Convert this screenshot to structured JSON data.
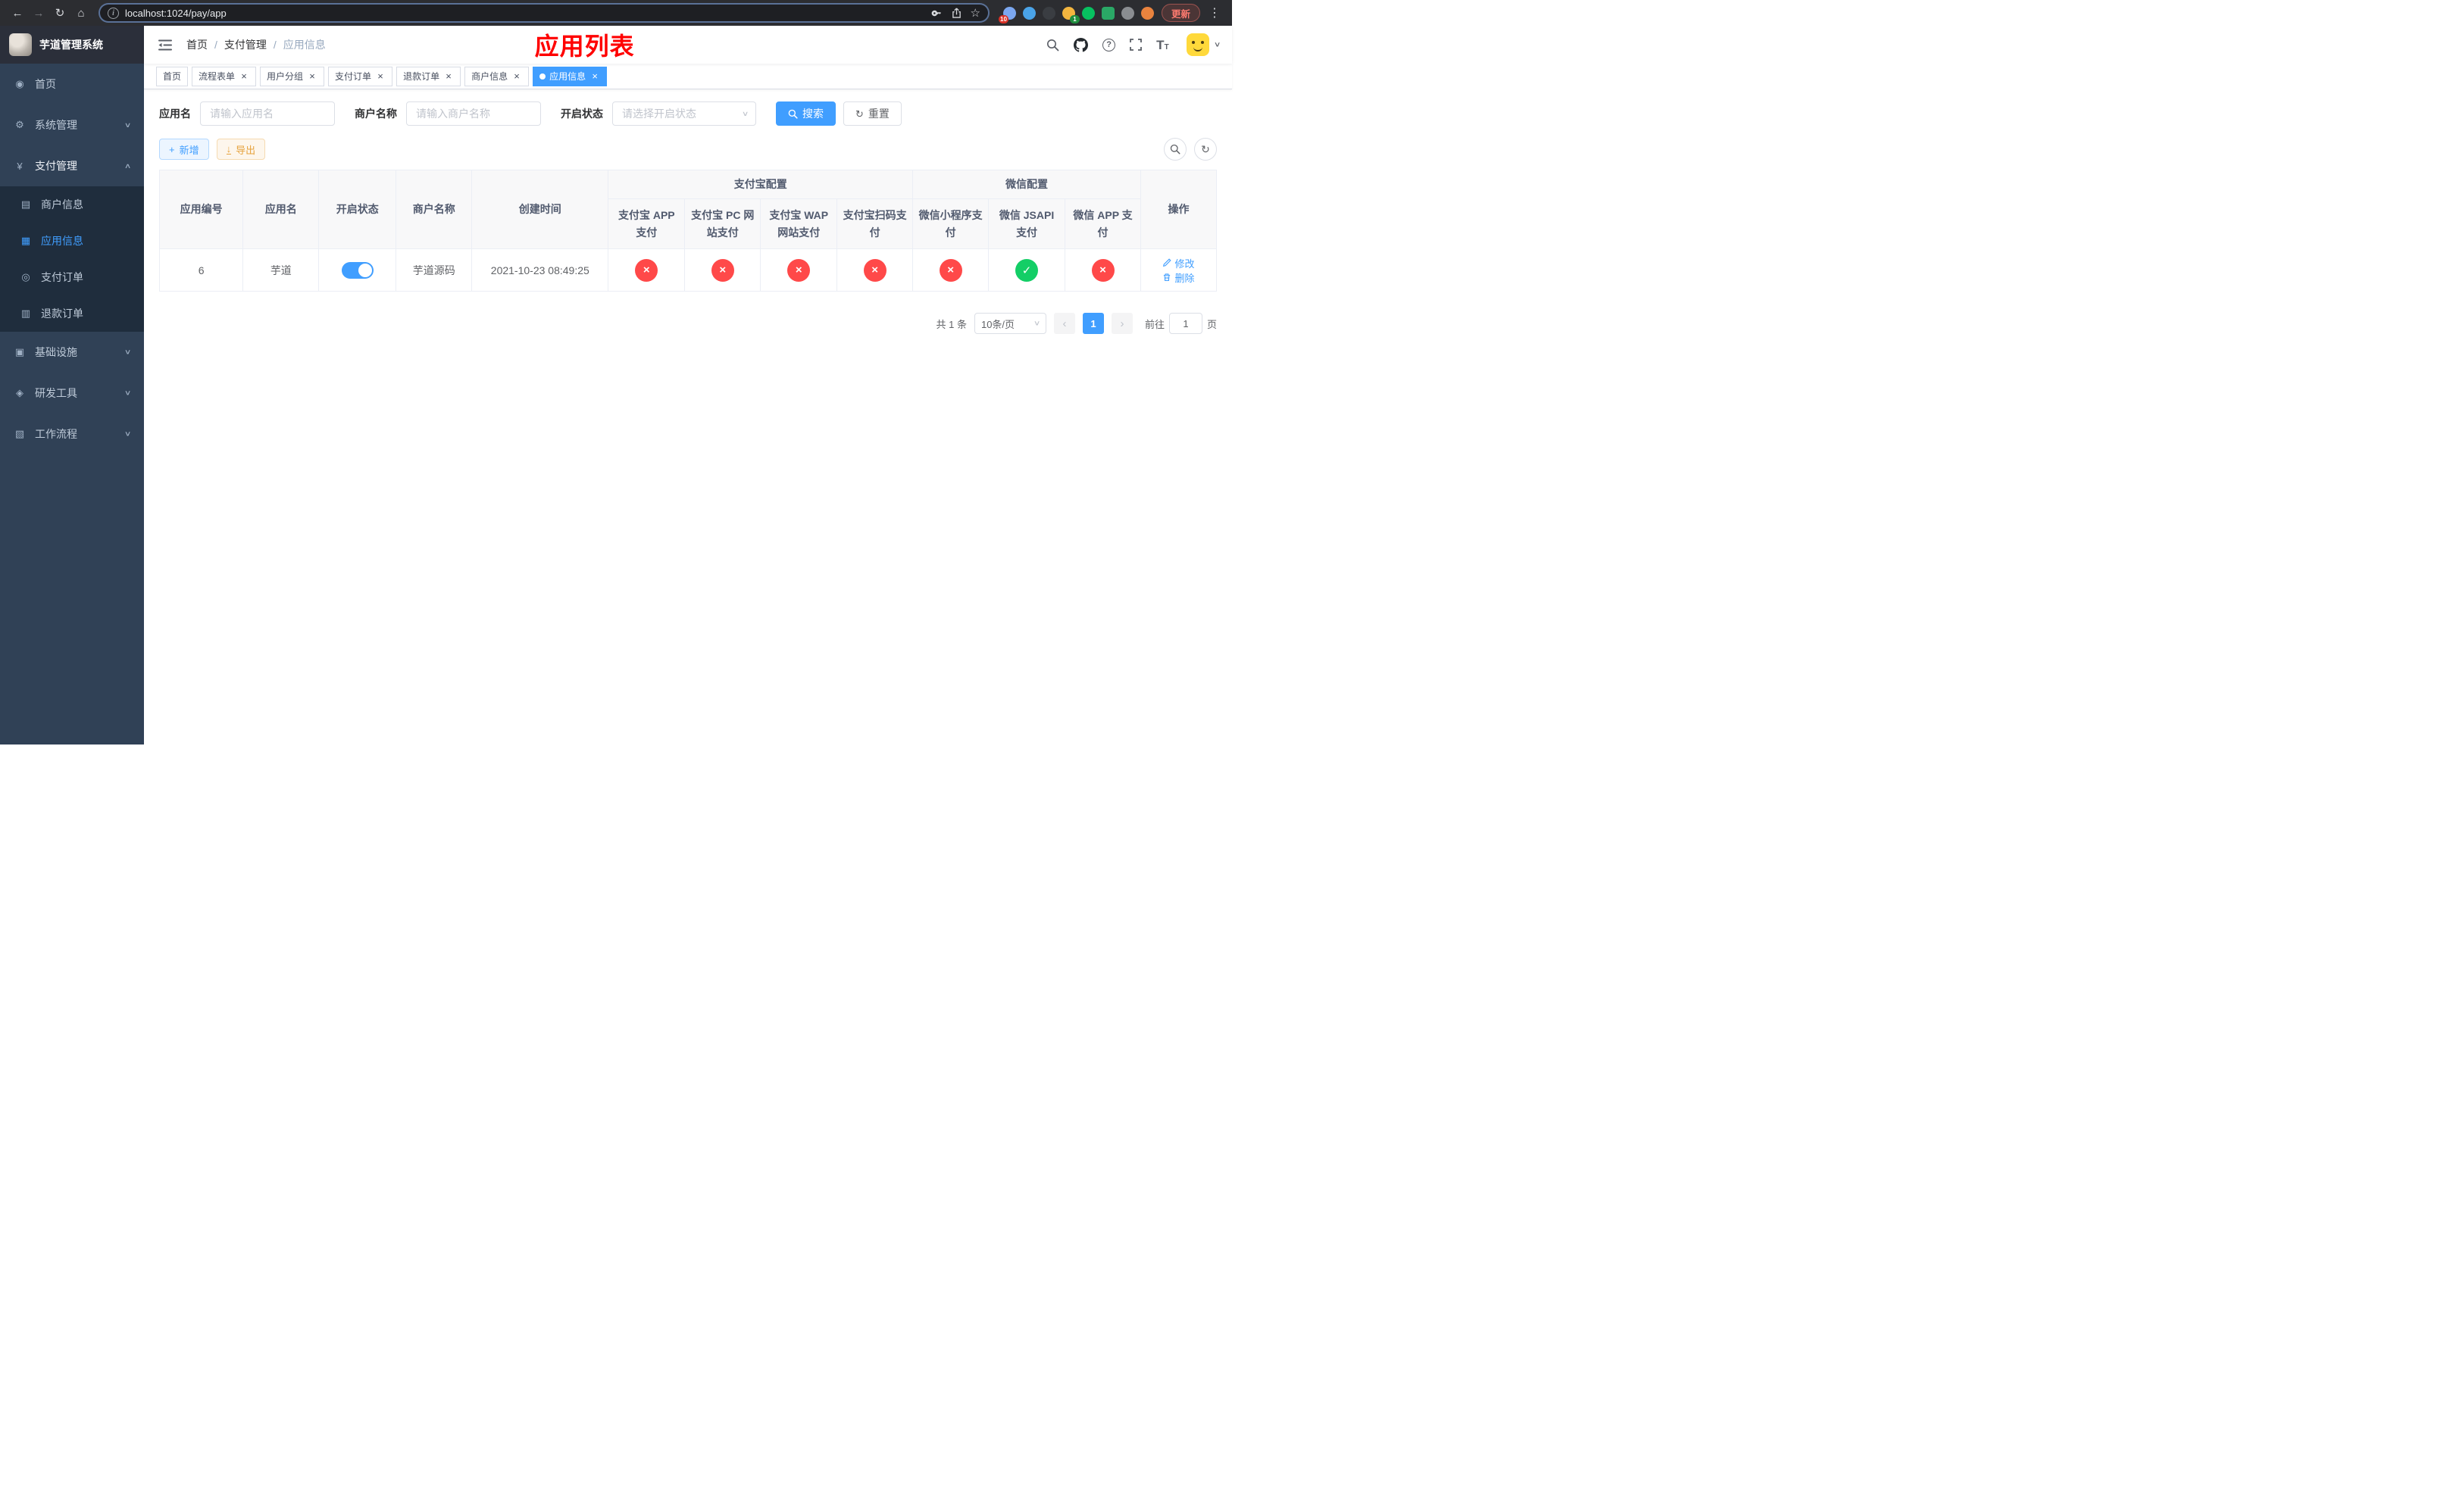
{
  "browser": {
    "url": "localhost:1024/pay/app",
    "update_label": "更新",
    "ext_badge_red": "10",
    "ext_badge_green": "1"
  },
  "icons": {
    "back": "←",
    "forward": "→",
    "reload": "↻",
    "home": "⌂",
    "site_info": "i",
    "star": "☆",
    "menu_dots": "⋮",
    "caret_down": "∨",
    "plus": "+",
    "download": "↓",
    "refresh": "↻",
    "close": "×",
    "prev": "‹",
    "next": "›",
    "help": "?",
    "font_size": "T"
  },
  "sidebar": {
    "title": "芋道管理系统",
    "menu": [
      {
        "label": "首页",
        "icon": "◉"
      },
      {
        "label": "系统管理",
        "icon": "⚙",
        "chevron": "∨"
      },
      {
        "label": "支付管理",
        "icon": "¥",
        "chevron": "∧"
      },
      {
        "label": "基础设施",
        "icon": "▣",
        "chevron": "∨"
      },
      {
        "label": "研发工具",
        "icon": "◈",
        "chevron": "∨"
      },
      {
        "label": "工作流程",
        "icon": "▧",
        "chevron": "∨"
      }
    ],
    "submenu": [
      {
        "label": "商户信息",
        "icon": "▤"
      },
      {
        "label": "应用信息",
        "icon": "▦"
      },
      {
        "label": "支付订单",
        "icon": "◎"
      },
      {
        "label": "退款订单",
        "icon": "▥"
      }
    ]
  },
  "navbar": {
    "breadcrumb": [
      "首页",
      "支付管理",
      "应用信息"
    ],
    "separator": "/",
    "annotation": "应用列表",
    "annotation_color": "#FF0000"
  },
  "tags": {
    "items": [
      {
        "label": "首页"
      },
      {
        "label": "流程表单"
      },
      {
        "label": "用户分组"
      },
      {
        "label": "支付订单"
      },
      {
        "label": "退款订单"
      },
      {
        "label": "商户信息"
      },
      {
        "label": "应用信息"
      }
    ]
  },
  "filter": {
    "app_name_label": "应用名",
    "app_name_placeholder": "请输入应用名",
    "merchant_label": "商户名称",
    "merchant_placeholder": "请输入商户名称",
    "status_label": "开启状态",
    "status_placeholder": "请选择开启状态",
    "search_label": "搜索",
    "reset_label": "重置"
  },
  "toolbar": {
    "add_label": "新增",
    "export_label": "导出"
  },
  "table": {
    "headers": {
      "app_id": "应用编号",
      "app_name": "应用名",
      "status": "开启状态",
      "merchant": "商户名称",
      "created": "创建时间",
      "alipay_group": "支付宝配置",
      "wechat_group": "微信配置",
      "alipay_app": "支付宝 APP 支付",
      "alipay_pc": "支付宝 PC 网站支付",
      "alipay_wap": "支付宝 WAP 网站支付",
      "alipay_qr": "支付宝扫码支付",
      "wechat_mini": "微信小程序支付",
      "wechat_jsapi": "微信 JSAPI 支付",
      "wechat_app": "微信 APP 支付",
      "actions": "操作"
    },
    "row": {
      "app_id": "6",
      "app_name": "芋道",
      "status_on": true,
      "merchant": "芋道源码",
      "created": "2021-10-23 08:49:25",
      "configs": [
        {
          "name": "alipay_app",
          "state": "fail",
          "glyph": "×"
        },
        {
          "name": "alipay_pc",
          "state": "fail",
          "glyph": "×"
        },
        {
          "name": "alipay_wap",
          "state": "fail",
          "glyph": "×"
        },
        {
          "name": "alipay_qr",
          "state": "fail",
          "glyph": "×"
        },
        {
          "name": "wechat_mini",
          "state": "fail",
          "glyph": "×"
        },
        {
          "name": "wechat_jsapi",
          "state": "pass",
          "glyph": "✓"
        },
        {
          "name": "wechat_app",
          "state": "fail",
          "glyph": "×"
        }
      ],
      "edit_label": "修改",
      "delete_label": "删除"
    }
  },
  "pagination": {
    "total": "共 1 条",
    "page_size": "10条/页",
    "current_page": "1",
    "goto_label": "前往",
    "goto_value": "1",
    "unit_label": "页"
  },
  "colors": {
    "accent": "#409EFF",
    "success": "#13CE66",
    "danger": "#FF4949",
    "warning": "#E6A23C",
    "sidebar_bg": "#304156",
    "submenu_bg": "#1F2D3D"
  }
}
